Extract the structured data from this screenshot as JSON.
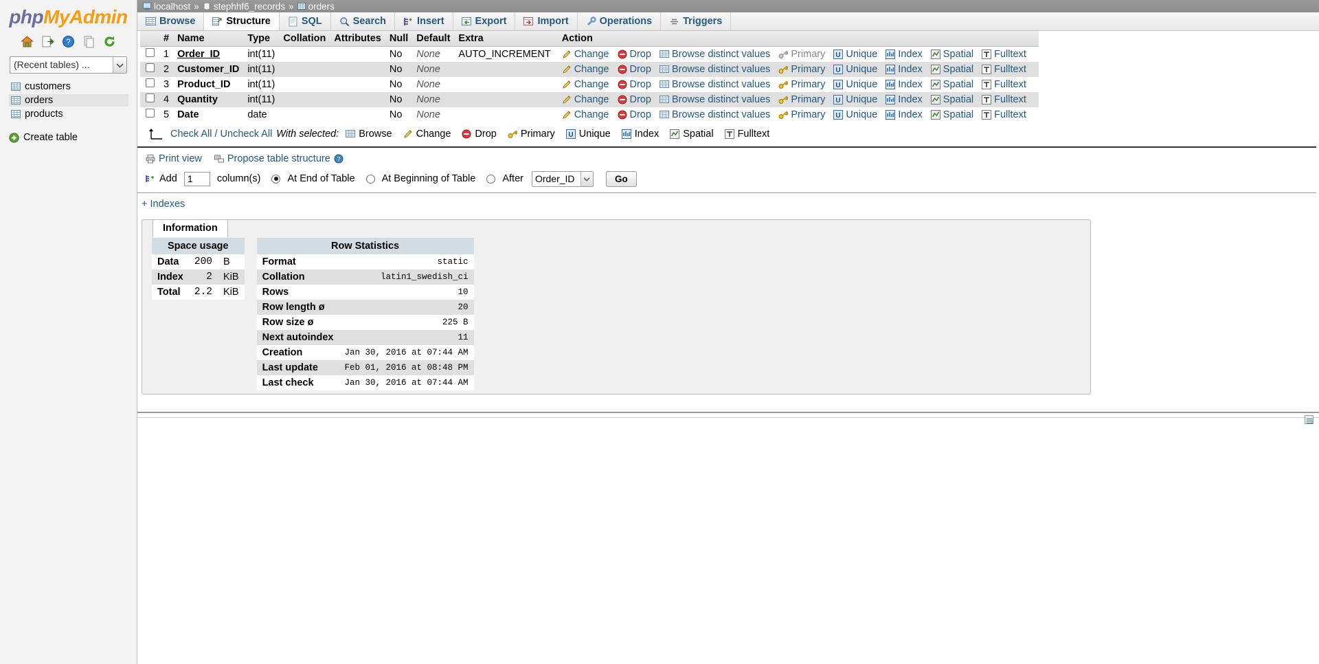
{
  "sidebar": {
    "logo": {
      "php": "php",
      "my": "My",
      "admin": "Admin"
    },
    "icons": [
      {
        "name": "home-icon",
        "title": "Home"
      },
      {
        "name": "logout-icon",
        "title": "Log out"
      },
      {
        "name": "help-icon",
        "title": "phpMyAdmin documentation"
      },
      {
        "name": "docs-icon",
        "title": "Documentation"
      },
      {
        "name": "reload-icon",
        "title": "Reload navigation"
      }
    ],
    "recent_select": "(Recent tables) ...",
    "tables": [
      {
        "label": "customers",
        "active": false
      },
      {
        "label": "orders",
        "active": true
      },
      {
        "label": "products",
        "active": false
      }
    ],
    "create_table": "Create table"
  },
  "breadcrumb": {
    "server": "localhost",
    "database": "stephhf6_records",
    "table": "orders",
    "separator": "»"
  },
  "tabs": [
    {
      "label": "Browse",
      "icon": "browse-icon",
      "active": false
    },
    {
      "label": "Structure",
      "icon": "structure-icon",
      "active": true
    },
    {
      "label": "SQL",
      "icon": "sql-icon",
      "active": false
    },
    {
      "label": "Search",
      "icon": "search-icon",
      "active": false
    },
    {
      "label": "Insert",
      "icon": "insert-icon",
      "active": false
    },
    {
      "label": "Export",
      "icon": "export-icon",
      "active": false
    },
    {
      "label": "Import",
      "icon": "import-icon",
      "active": false
    },
    {
      "label": "Operations",
      "icon": "operations-icon",
      "active": false
    },
    {
      "label": "Triggers",
      "icon": "triggers-icon",
      "active": false
    }
  ],
  "structure": {
    "headers": [
      "#",
      "Name",
      "Type",
      "Collation",
      "Attributes",
      "Null",
      "Default",
      "Extra",
      "Action"
    ],
    "action_labels": {
      "change": "Change",
      "drop": "Drop",
      "browse_distinct": "Browse distinct values",
      "primary": "Primary",
      "unique": "Unique",
      "index": "Index",
      "spatial": "Spatial",
      "fulltext": "Fulltext"
    },
    "rows": [
      {
        "num": "1",
        "name": "Order_ID",
        "primary_key": true,
        "type": "int(11)",
        "collation": "",
        "attributes": "",
        "null": "No",
        "default": "None",
        "extra": "AUTO_INCREMENT",
        "primary_disabled": true
      },
      {
        "num": "2",
        "name": "Customer_ID",
        "primary_key": false,
        "type": "int(11)",
        "collation": "",
        "attributes": "",
        "null": "No",
        "default": "None",
        "extra": "",
        "primary_disabled": false
      },
      {
        "num": "3",
        "name": "Product_ID",
        "primary_key": false,
        "type": "int(11)",
        "collation": "",
        "attributes": "",
        "null": "No",
        "default": "None",
        "extra": "",
        "primary_disabled": false
      },
      {
        "num": "4",
        "name": "Quantity",
        "primary_key": false,
        "type": "int(11)",
        "collation": "",
        "attributes": "",
        "null": "No",
        "default": "None",
        "extra": "",
        "primary_disabled": false
      },
      {
        "num": "5",
        "name": "Date",
        "primary_key": false,
        "type": "date",
        "collation": "",
        "attributes": "",
        "null": "No",
        "default": "None",
        "extra": "",
        "primary_disabled": false
      }
    ]
  },
  "with_selected": {
    "check_all": "Check All / Uncheck All",
    "label": "With selected:",
    "actions": [
      {
        "label": "Browse",
        "icon": "browse-icon"
      },
      {
        "label": "Change",
        "icon": "pencil-icon"
      },
      {
        "label": "Drop",
        "icon": "drop-icon"
      },
      {
        "label": "Primary",
        "icon": "key-icon"
      },
      {
        "label": "Unique",
        "icon": "unique-icon"
      },
      {
        "label": "Index",
        "icon": "index-icon"
      },
      {
        "label": "Spatial",
        "icon": "spatial-icon"
      },
      {
        "label": "Fulltext",
        "icon": "fulltext-icon"
      }
    ]
  },
  "tools": {
    "print_view": "Print view",
    "propose_structure": "Propose table structure",
    "help_title": "Documentation"
  },
  "add_column": {
    "add_label": "Add",
    "count_value": "1",
    "columns_label": "column(s)",
    "at_end_label": "At End of Table",
    "at_beginning_label": "At Beginning of Table",
    "after_label": "After",
    "after_value": "Order_ID",
    "selected_position": "at_end",
    "go_label": "Go"
  },
  "indexes_link": "+ Indexes",
  "information": {
    "tab_label": "Information",
    "space_usage": {
      "header": "Space usage",
      "rows": [
        {
          "key": "Data",
          "value": "200",
          "unit": "B"
        },
        {
          "key": "Index",
          "value": "2",
          "unit": "KiB"
        },
        {
          "key": "Total",
          "value": "2.2",
          "unit": "KiB"
        }
      ]
    },
    "row_statistics": {
      "header": "Row Statistics",
      "rows": [
        {
          "key": "Format",
          "value": "static"
        },
        {
          "key": "Collation",
          "value": "latin1_swedish_ci"
        },
        {
          "key": "Rows",
          "value": "10"
        },
        {
          "key": "Row length ø",
          "value": "20"
        },
        {
          "key": "Row size ø",
          "value": "225 B"
        },
        {
          "key": "Next autoindex",
          "value": "11"
        },
        {
          "key": "Creation",
          "value": "Jan 30, 2016 at 07:44 AM"
        },
        {
          "key": "Last update",
          "value": "Feb 01, 2016 at 08:48 PM"
        },
        {
          "key": "Last check",
          "value": "Jan 30, 2016 at 07:44 AM"
        }
      ]
    }
  }
}
